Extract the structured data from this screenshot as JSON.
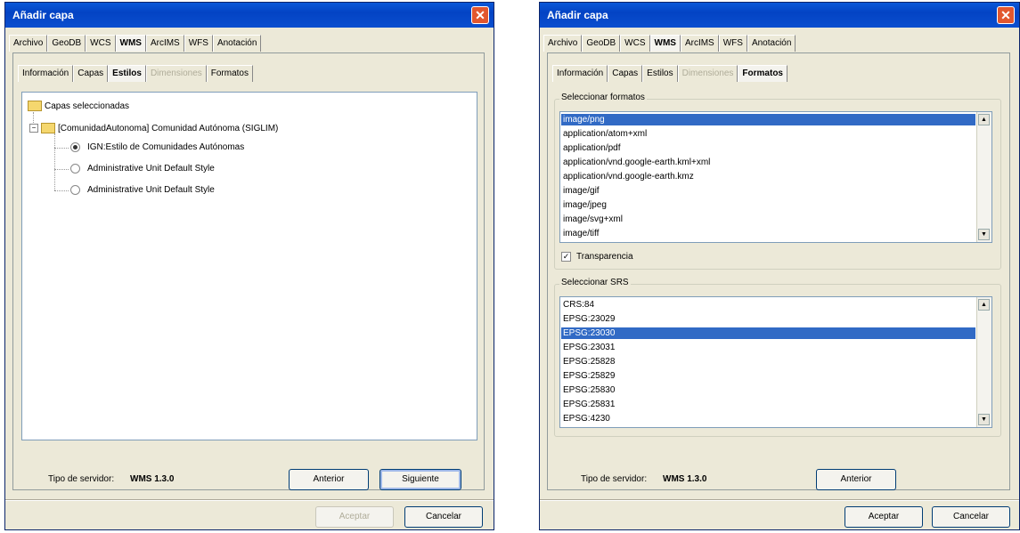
{
  "left": {
    "title": "Añadir capa",
    "close": "✕",
    "top_tabs": [
      "Archivo",
      "GeoDB",
      "WCS",
      "WMS",
      "ArcIMS",
      "WFS",
      "Anotación"
    ],
    "sub_tabs": [
      "Información",
      "Capas",
      "Estilos",
      "Dimensiones",
      "Formatos"
    ],
    "tree": {
      "root": "Capas seleccionadas",
      "layer": "[ComunidadAutonoma] Comunidad Autónoma (SIGLIM)",
      "styles": [
        "IGN:Estilo de Comunidades Autónomas",
        "Administrative Unit Default Style",
        "Administrative Unit Default Style"
      ]
    },
    "server_label": "Tipo de servidor:",
    "server_value": "WMS 1.3.0",
    "btn_back": "Anterior",
    "btn_next": "Siguiente",
    "btn_accept": "Aceptar",
    "btn_cancel": "Cancelar"
  },
  "right": {
    "title": "Añadir capa",
    "close": "✕",
    "top_tabs": [
      "Archivo",
      "GeoDB",
      "WCS",
      "WMS",
      "ArcIMS",
      "WFS",
      "Anotación"
    ],
    "sub_tabs": [
      "Información",
      "Capas",
      "Estilos",
      "Dimensiones",
      "Formatos"
    ],
    "formats_title": "Seleccionar formatos",
    "formats": [
      "image/png",
      "application/atom+xml",
      "application/pdf",
      "application/vnd.google-earth.kml+xml",
      "application/vnd.google-earth.kmz",
      "image/gif",
      "image/jpeg",
      "image/svg+xml",
      "image/tiff"
    ],
    "transparency_label": "Transparencia",
    "srs_title": "Seleccionar SRS",
    "srs": [
      "CRS:84",
      "EPSG:23029",
      "EPSG:23030",
      "EPSG:23031",
      "EPSG:25828",
      "EPSG:25829",
      "EPSG:25830",
      "EPSG:25831",
      "EPSG:4230"
    ],
    "server_label": "Tipo de servidor:",
    "server_value": "WMS 1.3.0",
    "btn_back": "Anterior",
    "btn_accept": "Aceptar",
    "btn_cancel": "Cancelar"
  }
}
